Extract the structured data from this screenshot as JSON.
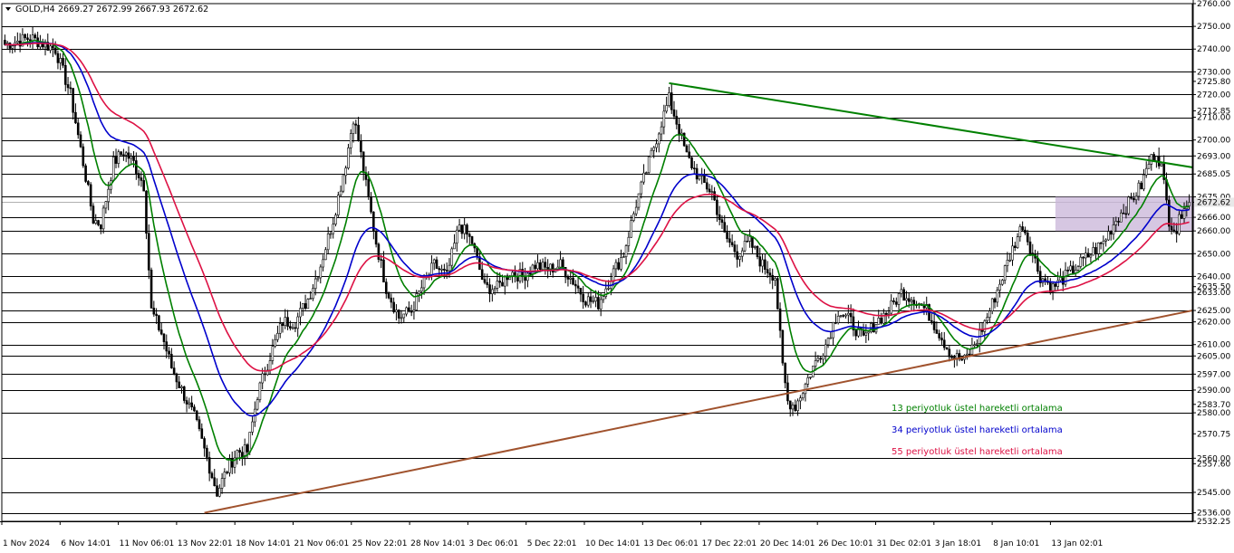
{
  "header": {
    "symbol": "GOLD,H4",
    "ohlc": "2669.27 2672.99 2667.93 2672.62",
    "arrow": "down-triangle-icon"
  },
  "chart_data": {
    "type": "candlestick",
    "title": "",
    "xlabel": "",
    "ylabel": "",
    "ylim": [
      2532.25,
      2760.0
    ],
    "grid": false,
    "x_ticks": [
      "1 Nov 2024",
      "6 Nov 14:01",
      "11 Nov 06:01",
      "13 Nov 22:01",
      "18 Nov 14:01",
      "21 Nov 06:01",
      "25 Nov 22:01",
      "28 Nov 14:01",
      "3 Dec 06:01",
      "5 Dec 22:01",
      "10 Dec 14:01",
      "13 Dec 06:01",
      "17 Dec 22:01",
      "20 Dec 14:01",
      "26 Dec 10:01",
      "31 Dec 02:01",
      "3 Jan 18:01",
      "8 Jan 10:01",
      "13 Jan 02:01"
    ],
    "y_tick_labels": [
      {
        "label": "2760.00",
        "value": 2760.0
      },
      {
        "label": "2750.00",
        "value": 2750.0
      },
      {
        "label": "2740.00",
        "value": 2740.0
      },
      {
        "label": "2730.00",
        "value": 2730.0
      },
      {
        "label": "2725.80",
        "value": 2725.8
      },
      {
        "label": "2720.00",
        "value": 2720.0
      },
      {
        "label": "2712.85",
        "value": 2712.85
      },
      {
        "label": "2710.00",
        "value": 2710.0
      },
      {
        "label": "2700.00",
        "value": 2700.0
      },
      {
        "label": "2693.00",
        "value": 2693.0
      },
      {
        "label": "2685.05",
        "value": 2685.05
      },
      {
        "label": "2675.00",
        "value": 2675.0
      },
      {
        "label": "2672.62",
        "value": 2672.62
      },
      {
        "label": "2666.00",
        "value": 2666.0
      },
      {
        "label": "2660.00",
        "value": 2660.0
      },
      {
        "label": "2650.00",
        "value": 2650.0
      },
      {
        "label": "2640.00",
        "value": 2640.0
      },
      {
        "label": "2635.50",
        "value": 2635.5
      },
      {
        "label": "2633.00",
        "value": 2633.0
      },
      {
        "label": "2625.00",
        "value": 2625.0
      },
      {
        "label": "2620.00",
        "value": 2620.0
      },
      {
        "label": "2610.00",
        "value": 2610.0
      },
      {
        "label": "2605.00",
        "value": 2605.0
      },
      {
        "label": "2597.00",
        "value": 2597.0
      },
      {
        "label": "2590.00",
        "value": 2590.0
      },
      {
        "label": "2583.70",
        "value": 2583.7
      },
      {
        "label": "2580.00",
        "value": 2580.0
      },
      {
        "label": "2570.75",
        "value": 2570.75
      },
      {
        "label": "2560.00",
        "value": 2560.0
      },
      {
        "label": "2557.60",
        "value": 2557.6
      },
      {
        "label": "2545.00",
        "value": 2545.0
      },
      {
        "label": "2536.00",
        "value": 2536.0
      },
      {
        "label": "2532.25",
        "value": 2532.25
      }
    ],
    "horizontal_levels": [
      2750,
      2740,
      2730,
      2720,
      2710,
      2700,
      2693,
      2685.05,
      2675,
      2666,
      2660,
      2650,
      2640,
      2633,
      2625,
      2620,
      2610,
      2605,
      2597,
      2590,
      2580,
      2560,
      2545,
      2536
    ],
    "current_price": 2672.62,
    "price_path": [
      [
        0,
        2742
      ],
      [
        10,
        2745
      ],
      [
        20,
        2740
      ],
      [
        26,
        2720
      ],
      [
        31,
        2690
      ],
      [
        35,
        2665
      ],
      [
        38,
        2663
      ],
      [
        43,
        2690
      ],
      [
        47,
        2695
      ],
      [
        51,
        2690
      ],
      [
        55,
        2680
      ],
      [
        58,
        2625
      ],
      [
        62,
        2615
      ],
      [
        66,
        2600
      ],
      [
        70,
        2590
      ],
      [
        75,
        2578
      ],
      [
        80,
        2560
      ],
      [
        84,
        2545
      ],
      [
        88,
        2555
      ],
      [
        92,
        2563
      ],
      [
        96,
        2563
      ],
      [
        100,
        2588
      ],
      [
        105,
        2605
      ],
      [
        110,
        2620
      ],
      [
        115,
        2620
      ],
      [
        120,
        2630
      ],
      [
        125,
        2645
      ],
      [
        130,
        2665
      ],
      [
        135,
        2690
      ],
      [
        138,
        2710
      ],
      [
        140,
        2700
      ],
      [
        143,
        2680
      ],
      [
        147,
        2655
      ],
      [
        151,
        2635
      ],
      [
        156,
        2622
      ],
      [
        161,
        2625
      ],
      [
        165,
        2635
      ],
      [
        170,
        2645
      ],
      [
        175,
        2640
      ],
      [
        180,
        2663
      ],
      [
        185,
        2655
      ],
      [
        190,
        2635
      ],
      [
        195,
        2635
      ],
      [
        200,
        2642
      ],
      [
        205,
        2640
      ],
      [
        210,
        2645
      ],
      [
        215,
        2643
      ],
      [
        220,
        2645
      ],
      [
        225,
        2638
      ],
      [
        230,
        2630
      ],
      [
        235,
        2628
      ],
      [
        240,
        2640
      ],
      [
        245,
        2650
      ],
      [
        250,
        2672
      ],
      [
        255,
        2690
      ],
      [
        260,
        2708
      ],
      [
        263,
        2718
      ],
      [
        266,
        2708
      ],
      [
        270,
        2693
      ],
      [
        275,
        2683
      ],
      [
        280,
        2677
      ],
      [
        285,
        2658
      ],
      [
        290,
        2650
      ],
      [
        295,
        2655
      ],
      [
        300,
        2645
      ],
      [
        305,
        2640
      ],
      [
        308,
        2600
      ],
      [
        310,
        2585
      ],
      [
        313,
        2583
      ],
      [
        316,
        2590
      ],
      [
        320,
        2600
      ],
      [
        325,
        2610
      ],
      [
        330,
        2625
      ],
      [
        335,
        2620
      ],
      [
        340,
        2612
      ],
      [
        345,
        2620
      ],
      [
        350,
        2625
      ],
      [
        355,
        2633
      ],
      [
        360,
        2630
      ],
      [
        365,
        2625
      ],
      [
        370,
        2615
      ],
      [
        375,
        2605
      ],
      [
        380,
        2603
      ],
      [
        385,
        2612
      ],
      [
        390,
        2625
      ],
      [
        395,
        2640
      ],
      [
        400,
        2655
      ],
      [
        403,
        2663
      ],
      [
        407,
        2650
      ],
      [
        410,
        2640
      ],
      [
        415,
        2635
      ],
      [
        420,
        2640
      ],
      [
        425,
        2645
      ],
      [
        430,
        2650
      ],
      [
        435,
        2655
      ],
      [
        440,
        2665
      ],
      [
        445,
        2672
      ],
      [
        450,
        2680
      ],
      [
        453,
        2690
      ],
      [
        456,
        2695
      ],
      [
        458,
        2688
      ],
      [
        461,
        2665
      ],
      [
        464,
        2660
      ],
      [
        467,
        2672.62
      ]
    ],
    "series": [
      {
        "name": "13 periyotluk üstel hareketli ortalama",
        "color": "#008000",
        "period": 13
      },
      {
        "name": "34 periyotluk üstel hareketli ortalama",
        "color": "#0000cc",
        "period": 34
      },
      {
        "name": "55 periyotluk üstel hareketli ortalama",
        "color": "#dd1144",
        "period": 55
      }
    ],
    "trendlines": [
      {
        "color": "#008000",
        "from": {
          "x": "10 Dec 14:01 +4 bars",
          "y": 2725
        },
        "to": {
          "x": "beyond 13 Jan 02:01",
          "y": 2688
        }
      },
      {
        "color": "#a0522d",
        "from": {
          "x": "13 Nov 22:01 +1 bar",
          "y": 2536
        },
        "to": {
          "x": "beyond 13 Jan 02:01",
          "y": 2625
        }
      }
    ],
    "zone": {
      "color": "#c8b4d8",
      "y_low": 2660,
      "y_high": 2675,
      "x_start": "3 Jan 18:01",
      "x_end": "13 Jan 02:01 +3 bars"
    }
  },
  "legend": {
    "items": [
      {
        "label": "13 periyotluk üstel hareketli ortalama",
        "color": "#008000"
      },
      {
        "label": "34 periyotluk üstel hareketli ortalama",
        "color": "#0000cc"
      },
      {
        "label": "55 periyotluk üstel hareketli ortalama",
        "color": "#dd1144"
      }
    ]
  }
}
